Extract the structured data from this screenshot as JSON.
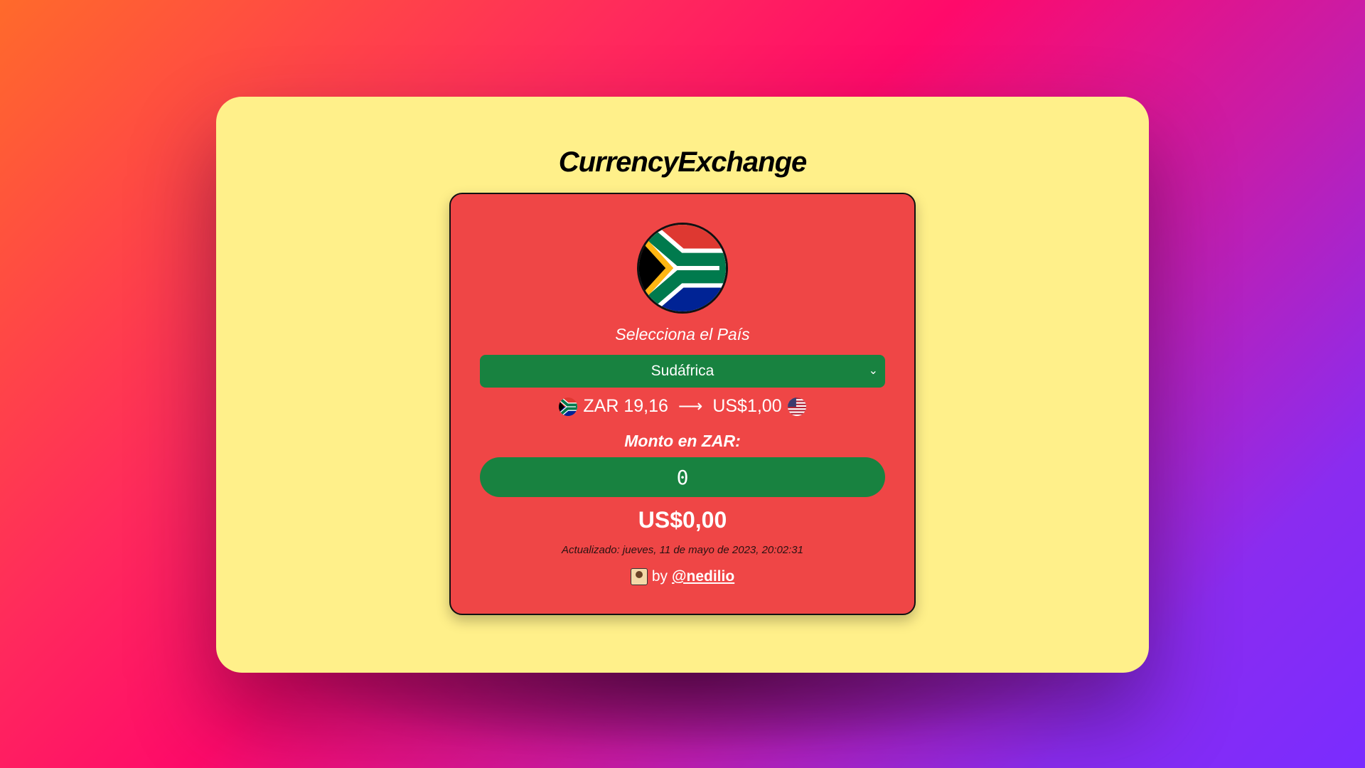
{
  "app": {
    "title": "CurrencyExchange"
  },
  "selector": {
    "label": "Selecciona el País",
    "selected": "Sudáfrica"
  },
  "rate": {
    "from": "ZAR 19,16",
    "to": "US$1,00"
  },
  "amount": {
    "label": "Monto en ZAR:",
    "value": "0"
  },
  "result": {
    "value": "US$0,00"
  },
  "updated": {
    "text": "Actualizado: jueves, 11 de mayo de 2023, 20:02:31"
  },
  "credit": {
    "by": "by",
    "handle": "@nedilio"
  },
  "colors": {
    "window": "#fff08a",
    "card": "#ef4646",
    "control": "#188240"
  }
}
